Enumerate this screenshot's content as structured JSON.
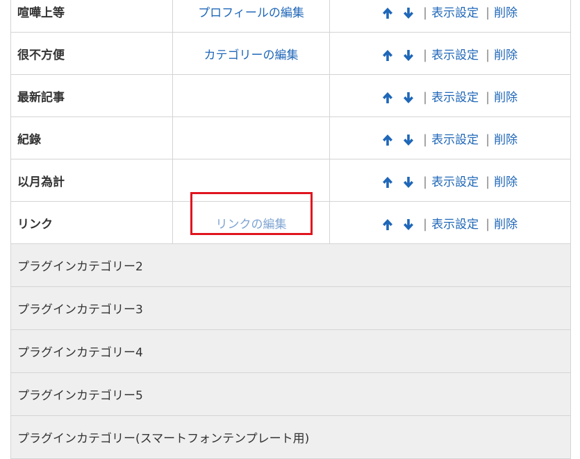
{
  "plugins": [
    {
      "name": "喧嘩上等",
      "edit_label": "プロフィールの編集"
    },
    {
      "name": "很不方便",
      "edit_label": "カテゴリーの編集"
    },
    {
      "name": "最新記事",
      "edit_label": ""
    },
    {
      "name": "紀錄",
      "edit_label": ""
    },
    {
      "name": "以月為計",
      "edit_label": ""
    },
    {
      "name": "リンク",
      "edit_label": "リンクの編集"
    }
  ],
  "actions": {
    "settings_label": "表示設定",
    "delete_label": "削除",
    "separator": "|"
  },
  "categories": [
    "プラグインカテゴリー2",
    "プラグインカテゴリー3",
    "プラグインカテゴリー4",
    "プラグインカテゴリー5",
    "プラグインカテゴリー(スマートフォンテンプレート用)"
  ],
  "colors": {
    "link": "#1f67b8",
    "highlight": "#e0141e",
    "category_bg": "#efefef"
  }
}
